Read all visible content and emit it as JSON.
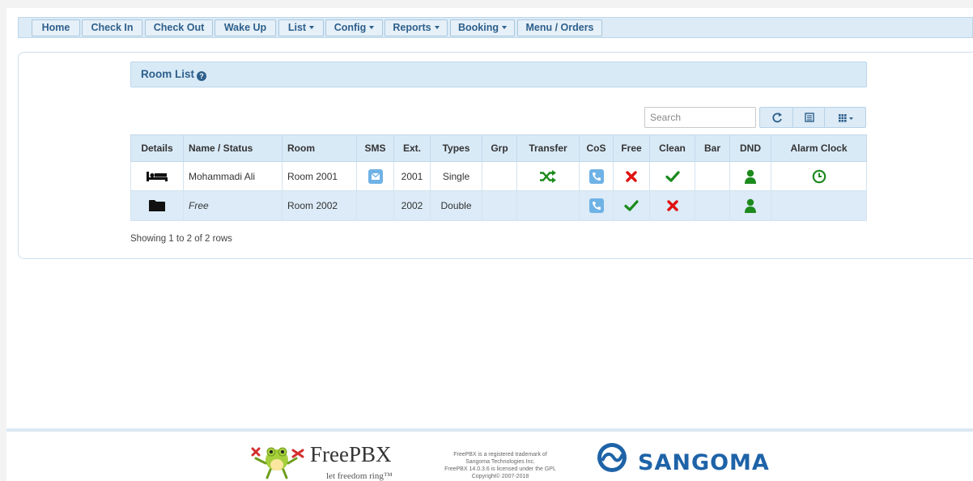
{
  "nav": {
    "home": "Home",
    "check_in": "Check In",
    "check_out": "Check Out",
    "wake_up": "Wake Up",
    "list": "List",
    "config": "Config",
    "reports": "Reports",
    "booking": "Booking",
    "menu_orders": "Menu / Orders"
  },
  "section": {
    "title": "Room List"
  },
  "search": {
    "placeholder": "Search"
  },
  "table": {
    "headers": [
      "Details",
      "Name / Status",
      "Room",
      "SMS",
      "Ext.",
      "Types",
      "Grp",
      "Transfer",
      "CoS",
      "Free",
      "Clean",
      "Bar",
      "DND",
      "Alarm Clock"
    ],
    "rows": [
      {
        "details_icon": "bed-icon",
        "name": "Mohammadi Ali",
        "room": "Room 2001",
        "sms_icon": "envelope-icon",
        "ext": "2001",
        "type": "Single",
        "grp": "",
        "transfer_icon": "shuffle-icon",
        "cos_icon": "phone-icon",
        "free": "no",
        "clean": "yes",
        "bar": "",
        "dnd_icon": "user-icon",
        "alarm_icon": "clock-icon"
      },
      {
        "details_icon": "folder-icon",
        "name": "Free",
        "room": "Room 2002",
        "sms_icon": "",
        "ext": "2002",
        "type": "Double",
        "grp": "",
        "transfer_icon": "",
        "cos_icon": "phone-icon",
        "free": "yes",
        "clean": "no",
        "bar": "",
        "dnd_icon": "user-icon",
        "alarm_icon": ""
      }
    ]
  },
  "footer_info": "Showing 1 to 2 of 2 rows",
  "footer": {
    "freepbx_name": "FreePBX",
    "freepbx_tagline": "let freedom ring™",
    "legal_1": "FreePBX is a registered trademark of",
    "legal_2": "Sangoma Technologies Inc.",
    "legal_3": "FreePBX 14.0.3.6 is licensed under the GPL",
    "legal_4": "Copyright© 2007-2018",
    "sangoma": "SANGOMA"
  },
  "colors": {
    "accent": "#2d5f8b",
    "header_bg": "#d9eaf7",
    "check_green": "#1c8a1c",
    "cross_red": "#e01010",
    "icon_blue": "#6fb2e6",
    "sangoma_blue": "#1e63a8"
  }
}
